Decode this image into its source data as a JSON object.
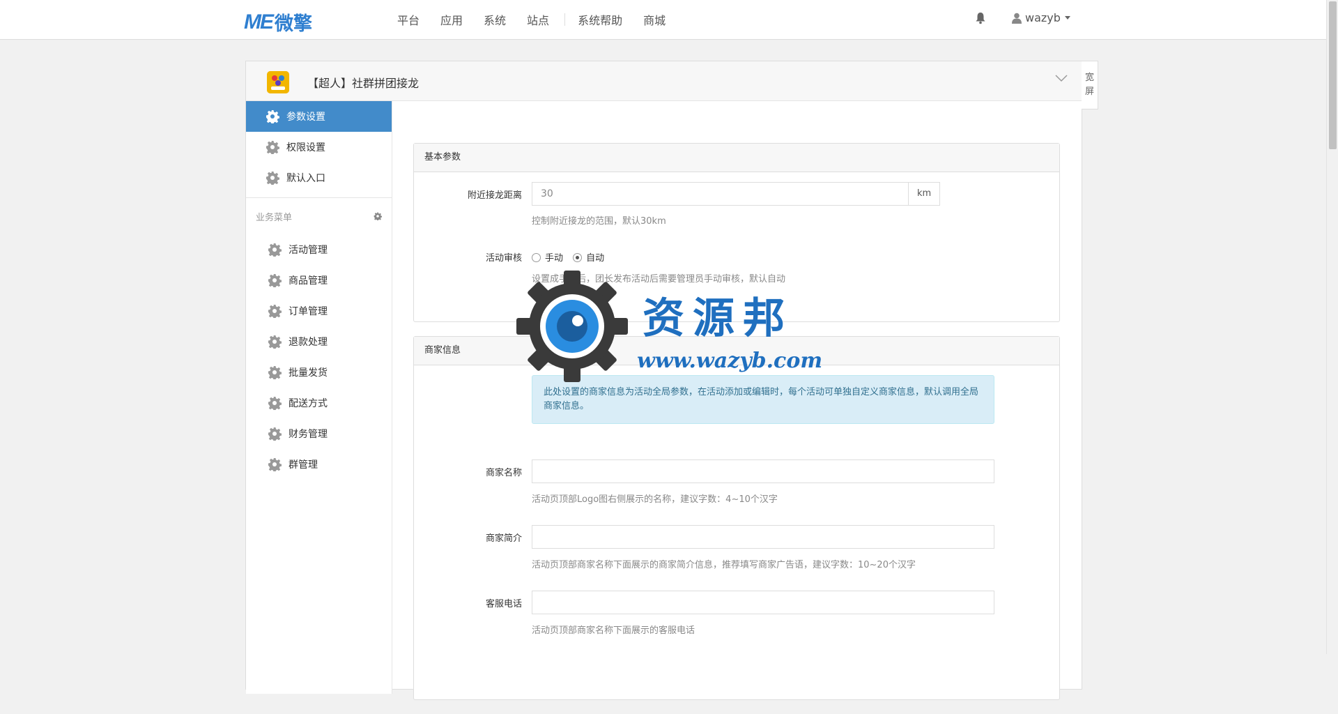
{
  "header": {
    "logo_me": "ME",
    "logo_cn": "微擎",
    "nav": [
      "平台",
      "应用",
      "系统",
      "站点",
      "系统帮助",
      "商城"
    ],
    "username": "wazyb"
  },
  "app": {
    "title": "【超人】社群拼团接龙",
    "wide_label": "宽屏"
  },
  "sidebar": {
    "top_items": [
      {
        "label": "参数设置",
        "active": true
      },
      {
        "label": "权限设置",
        "active": false
      },
      {
        "label": "默认入口",
        "active": false
      }
    ],
    "group_label": "业务菜单",
    "biz_items": [
      "活动管理",
      "商品管理",
      "订单管理",
      "退款处理",
      "批量发货",
      "配送方式",
      "财务管理",
      "群管理"
    ]
  },
  "basic": {
    "title": "基本参数",
    "distance_label": "附近接龙距离",
    "distance_value": "30",
    "distance_unit": "km",
    "distance_help": "控制附近接龙的范围，默认30km",
    "review_label": "活动审核",
    "review_manual": "手动",
    "review_auto": "自动",
    "review_selected": "自动",
    "review_help": "设置成手动后，团长发布活动后需要管理员手动审核，默认自动"
  },
  "merchant": {
    "title": "商家信息",
    "alert": "此处设置的商家信息为活动全局参数，在活动添加或编辑时，每个活动可单独自定义商家信息，默认调用全局商家信息。",
    "name_label": "商家名称",
    "name_value": "",
    "name_help": "活动页顶部Logo图右侧展示的名称，建议字数：4~10个汉字",
    "intro_label": "商家简介",
    "intro_value": "",
    "intro_help": "活动页顶部商家名称下面展示的商家简介信息，推荐填写商家广告语，建议字数：10~20个汉字",
    "phone_label": "客服电话",
    "phone_value": "",
    "phone_help": "活动页顶部商家名称下面展示的客服电话"
  },
  "watermark": {
    "title": "资源邦",
    "url": "www.wazyb.com"
  },
  "colors": {
    "accent": "#428bca",
    "brand": "#2f7fd0",
    "alert_bg": "#d9edf7"
  }
}
